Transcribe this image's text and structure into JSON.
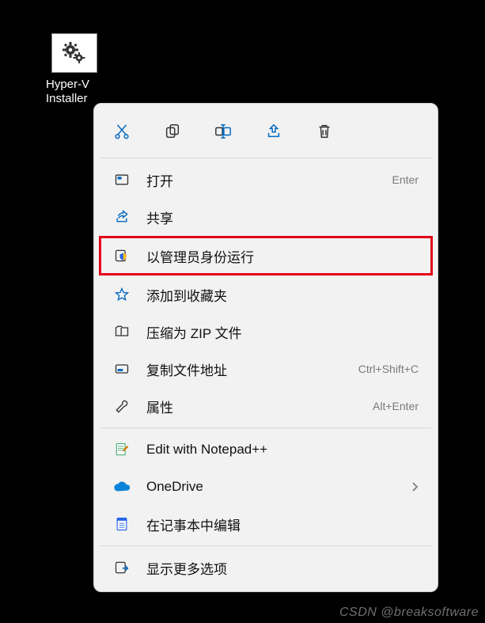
{
  "desktop": {
    "icon_label": "Hyper-V\nInstaller"
  },
  "toolbar": {
    "items": [
      {
        "name": "cut-icon"
      },
      {
        "name": "copy-icon"
      },
      {
        "name": "rename-icon"
      },
      {
        "name": "share-icon"
      },
      {
        "name": "delete-icon"
      }
    ]
  },
  "menu": {
    "groups": [
      {
        "items": [
          {
            "name": "open",
            "icon": "open-icon",
            "label": "打开",
            "shortcut": "Enter"
          },
          {
            "name": "share",
            "icon": "share-arrow-icon",
            "label": "共享",
            "shortcut": ""
          },
          {
            "name": "run-as-admin",
            "icon": "shield-icon",
            "label": "以管理员身份运行",
            "shortcut": "",
            "highlight": true
          },
          {
            "name": "add-favorite",
            "icon": "star-icon",
            "label": "添加到收藏夹",
            "shortcut": ""
          },
          {
            "name": "compress-zip",
            "icon": "folder-zip-icon",
            "label": "压缩为 ZIP 文件",
            "shortcut": ""
          },
          {
            "name": "copy-path",
            "icon": "copy-path-icon",
            "label": "复制文件地址",
            "shortcut": "Ctrl+Shift+C"
          },
          {
            "name": "properties",
            "icon": "wrench-icon",
            "label": "属性",
            "shortcut": "Alt+Enter"
          }
        ]
      },
      {
        "items": [
          {
            "name": "edit-notepadpp",
            "icon": "notepadpp-icon",
            "label": "Edit with Notepad++",
            "shortcut": ""
          },
          {
            "name": "onedrive",
            "icon": "onedrive-icon",
            "label": "OneDrive",
            "shortcut": "",
            "submenu": true
          },
          {
            "name": "edit-notepad",
            "icon": "notepad-icon",
            "label": "在记事本中编辑",
            "shortcut": ""
          }
        ]
      },
      {
        "items": [
          {
            "name": "show-more",
            "icon": "more-options-icon",
            "label": "显示更多选项",
            "shortcut": ""
          }
        ]
      }
    ]
  },
  "watermark": "CSDN @breaksoftware"
}
